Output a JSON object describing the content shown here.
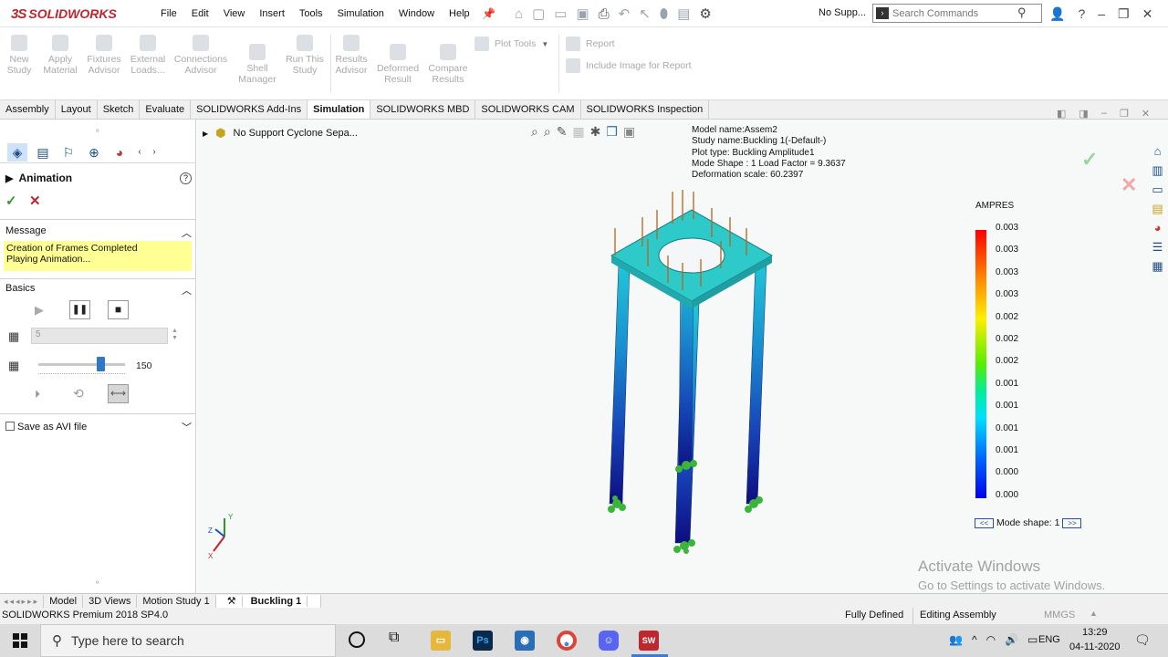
{
  "app": {
    "brand": "SOLIDWORKS",
    "brand_prefix": "3S"
  },
  "menu": [
    "File",
    "Edit",
    "View",
    "Insert",
    "Tools",
    "Simulation",
    "Window",
    "Help"
  ],
  "title_status": "No Supp...",
  "search": {
    "placeholder": "Search Commands"
  },
  "ribbon": {
    "buttons": [
      {
        "label": "New\nStudy"
      },
      {
        "label": "Apply\nMaterial"
      },
      {
        "label": "Fixtures\nAdvisor"
      },
      {
        "label": "External\nLoads..."
      },
      {
        "label": "Connections\nAdvisor"
      },
      {
        "label": "Shell\nManager"
      },
      {
        "label": "Run This\nStudy"
      },
      {
        "label": "Results\nAdvisor"
      },
      {
        "label": "Deformed\nResult"
      },
      {
        "label": "Compare\nResults"
      }
    ],
    "plot_tools": "Plot Tools",
    "report": "Report",
    "include_image": "Include Image for Report"
  },
  "command_tabs": [
    "Assembly",
    "Layout",
    "Sketch",
    "Evaluate",
    "SOLIDWORKS Add-Ins",
    "Simulation",
    "SOLIDWORKS MBD",
    "SOLIDWORKS CAM",
    "SOLIDWORKS Inspection"
  ],
  "active_command_tab": "Simulation",
  "property_manager": {
    "title": "Animation",
    "message_header": "Message",
    "message_line1": "Creation of Frames Completed",
    "message_line2": "Playing Animation...",
    "basics_header": "Basics",
    "frames_value": "5",
    "speed_value": "150",
    "speed_fraction": 0.72,
    "save_avi_label": "Save as AVI file"
  },
  "viewport": {
    "tree_label": "No Support Cyclone Sepa...",
    "study_info": [
      "Model name:Assem2",
      "Study name:Buckling 1(-Default-)",
      "Plot type: Buckling Amplitude1",
      "Mode Shape : 1  Load Factor = 9.3637",
      "Deformation scale: 60.2397"
    ],
    "legend_title": "AMPRES",
    "legend_values": [
      "0.003",
      "0.003",
      "0.003",
      "0.003",
      "0.002",
      "0.002",
      "0.002",
      "0.001",
      "0.001",
      "0.001",
      "0.001",
      "0.000",
      "0.000"
    ],
    "mode_shape_label": "Mode shape: 1",
    "mode_prev": "<<",
    "mode_next": ">>",
    "triad": {
      "y": "Y",
      "z": "Z",
      "x": "X"
    }
  },
  "watermark": {
    "line1": "Activate Windows",
    "line2": "Go to Settings to activate Windows."
  },
  "bottom_tabs": [
    "Model",
    "3D Views",
    "Motion Study 1",
    "Buckling 1"
  ],
  "active_bottom_tab": "Buckling 1",
  "status": {
    "version": "SOLIDWORKS Premium 2018 SP4.0",
    "defined": "Fully Defined",
    "mode": "Editing Assembly",
    "units": "MMGS"
  },
  "taskbar": {
    "search_placeholder": "Type here to search",
    "language": "ENG",
    "time": "13:29",
    "date": "04-11-2020"
  }
}
